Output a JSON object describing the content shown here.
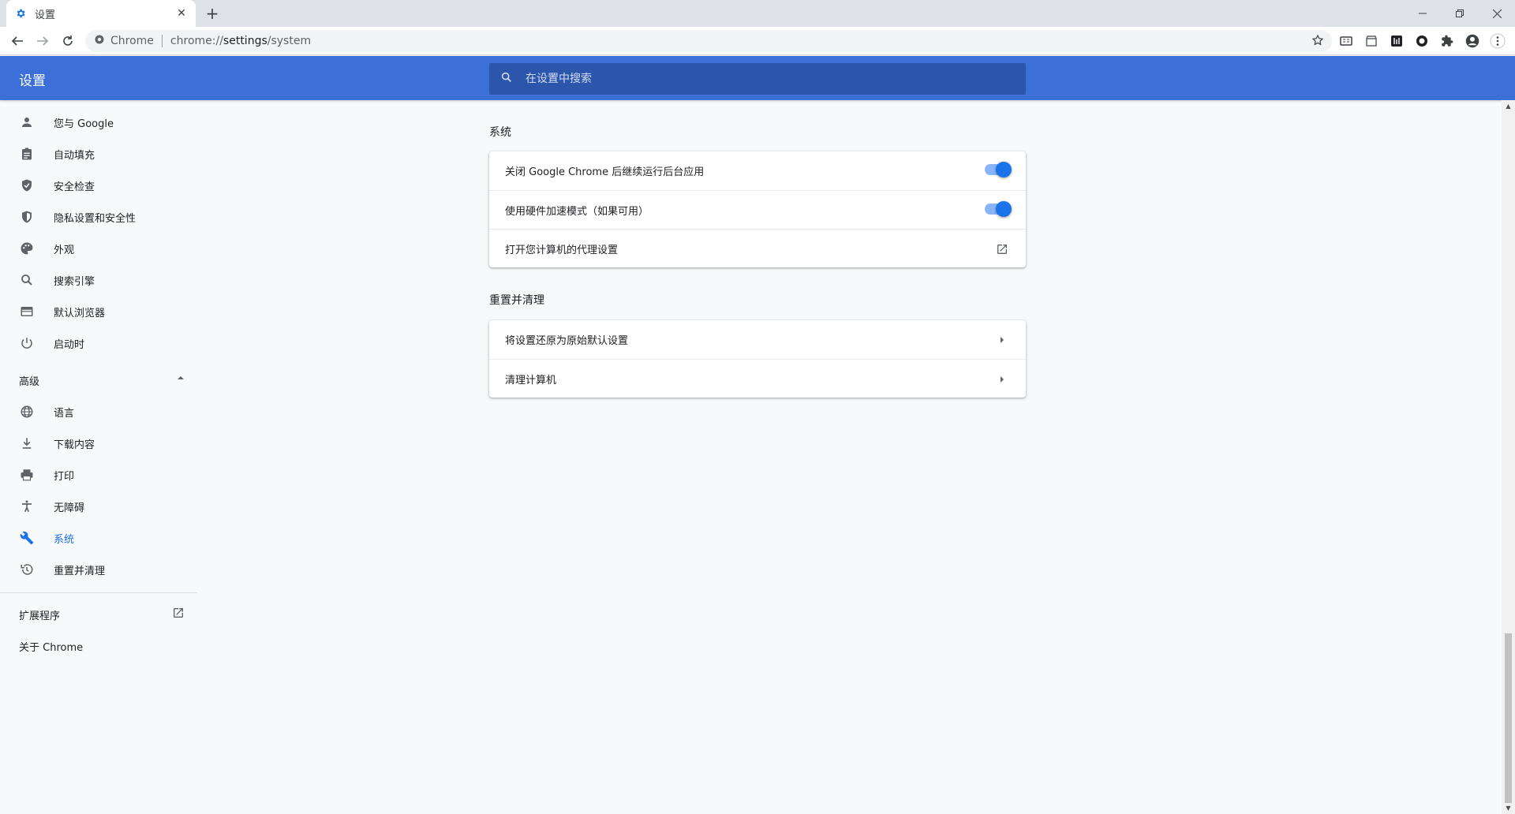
{
  "browser": {
    "tab_title": "设置",
    "omnibox_site": "Chrome",
    "omnibox_url_prefix": "chrome://",
    "omnibox_url_path": "settings",
    "omnibox_url_suffix": "/system"
  },
  "header": {
    "title": "设置",
    "search_placeholder": "在设置中搜索"
  },
  "sidebar": {
    "items": [
      {
        "label": "您与 Google",
        "icon": "person-icon"
      },
      {
        "label": "自动填充",
        "icon": "assignment-icon"
      },
      {
        "label": "安全检查",
        "icon": "shield-check-icon"
      },
      {
        "label": "隐私设置和安全性",
        "icon": "security-icon"
      },
      {
        "label": "外观",
        "icon": "palette-icon"
      },
      {
        "label": "搜索引擎",
        "icon": "search-icon"
      },
      {
        "label": "默认浏览器",
        "icon": "browser-icon"
      },
      {
        "label": "启动时",
        "icon": "power-icon"
      }
    ],
    "advanced_label": "高级",
    "advanced_items": [
      {
        "label": "语言",
        "icon": "globe-icon"
      },
      {
        "label": "下载内容",
        "icon": "download-icon"
      },
      {
        "label": "打印",
        "icon": "print-icon"
      },
      {
        "label": "无障碍",
        "icon": "accessibility-icon"
      },
      {
        "label": "系统",
        "icon": "wrench-icon",
        "active": true
      },
      {
        "label": "重置并清理",
        "icon": "restore-icon"
      }
    ],
    "extensions_label": "扩展程序",
    "about_label": "关于 Chrome"
  },
  "main": {
    "system_section": {
      "title": "系统",
      "rows": [
        {
          "label": "关闭 Google Chrome 后继续运行后台应用",
          "toggle_on": true
        },
        {
          "label": "使用硬件加速模式（如果可用）",
          "toggle_on": true
        },
        {
          "label": "打开您计算机的代理设置",
          "trailing": "open-in-new-icon"
        }
      ]
    },
    "reset_section": {
      "title": "重置并清理",
      "rows": [
        {
          "label": "将设置还原为原始默认设置",
          "trailing": "arrow-right-icon"
        },
        {
          "label": "清理计算机",
          "trailing": "arrow-right-icon"
        }
      ]
    }
  },
  "colors": {
    "header_bg": "#3c6fd8",
    "accent": "#1a73e8"
  }
}
